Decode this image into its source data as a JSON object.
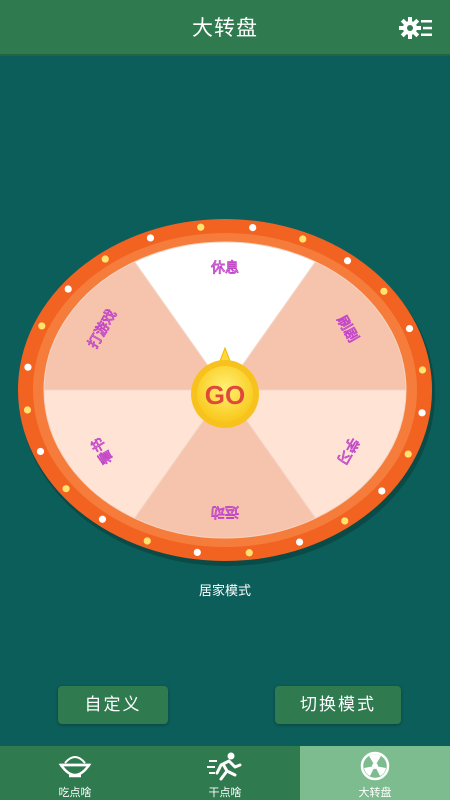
{
  "header": {
    "title": "大转盘",
    "settings_icon": "settings-gear-icon"
  },
  "wheel": {
    "center_label": "GO",
    "segments": [
      "休息",
      "刷剧",
      "学习",
      "运动",
      "看书",
      "打游戏"
    ],
    "colors": {
      "ring": "#f26322",
      "segment_light": "#ffe4d6",
      "segment_mid": "#f6c4ac",
      "segment_white": "#ffffff",
      "hub": "#ffd93b",
      "hub_text": "#e0483a",
      "segment_text": "#c246c8"
    }
  },
  "mode_label": "居家模式",
  "buttons": {
    "custom": "自定义",
    "switch_mode": "切换模式"
  },
  "tabs": [
    {
      "label": "吃点啥",
      "icon": "food-bowl-icon"
    },
    {
      "label": "干点啥",
      "icon": "running-person-icon"
    },
    {
      "label": "大转盘",
      "icon": "wheel-icon",
      "active": true
    }
  ]
}
